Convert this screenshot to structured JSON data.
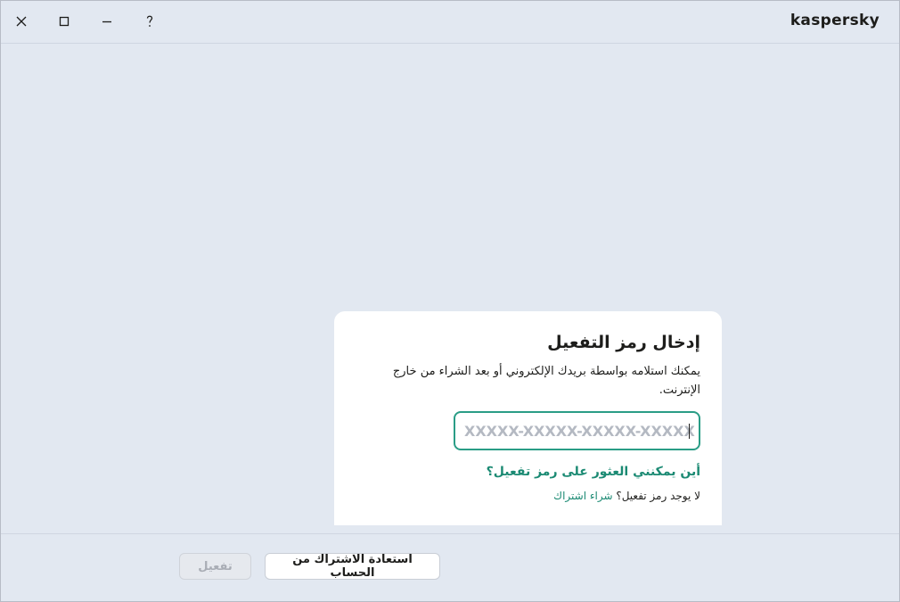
{
  "window": {
    "brand": "kaspersky",
    "controls": {
      "close_icon": "close-icon",
      "maximize_icon": "maximize-icon",
      "minimize_icon": "minimize-icon",
      "help_icon": "help-icon"
    }
  },
  "activation": {
    "title": "إدخال رمز التفعيل",
    "description": "يمكنك استلامه بواسطة بريدك الإلكتروني أو بعد الشراء من خارج الإنترنت.",
    "code_input": {
      "value": "",
      "placeholder": "XXXXX-XXXXX-XXXXX-XXXXX"
    },
    "find_code_link": "أين يمكنني العثور على رمز تفعيل؟",
    "no_code_text": "لا يوجد رمز تفعيل؟",
    "buy_link": "شراء اشتراك"
  },
  "footer": {
    "restore_button": "استعادة الاشتراك من الحساب",
    "activate_button": "تفعيل",
    "activate_enabled": false
  },
  "colors": {
    "accent": "#1b8a73",
    "input_border": "#2a9d86",
    "background": "#e2e8f1"
  }
}
